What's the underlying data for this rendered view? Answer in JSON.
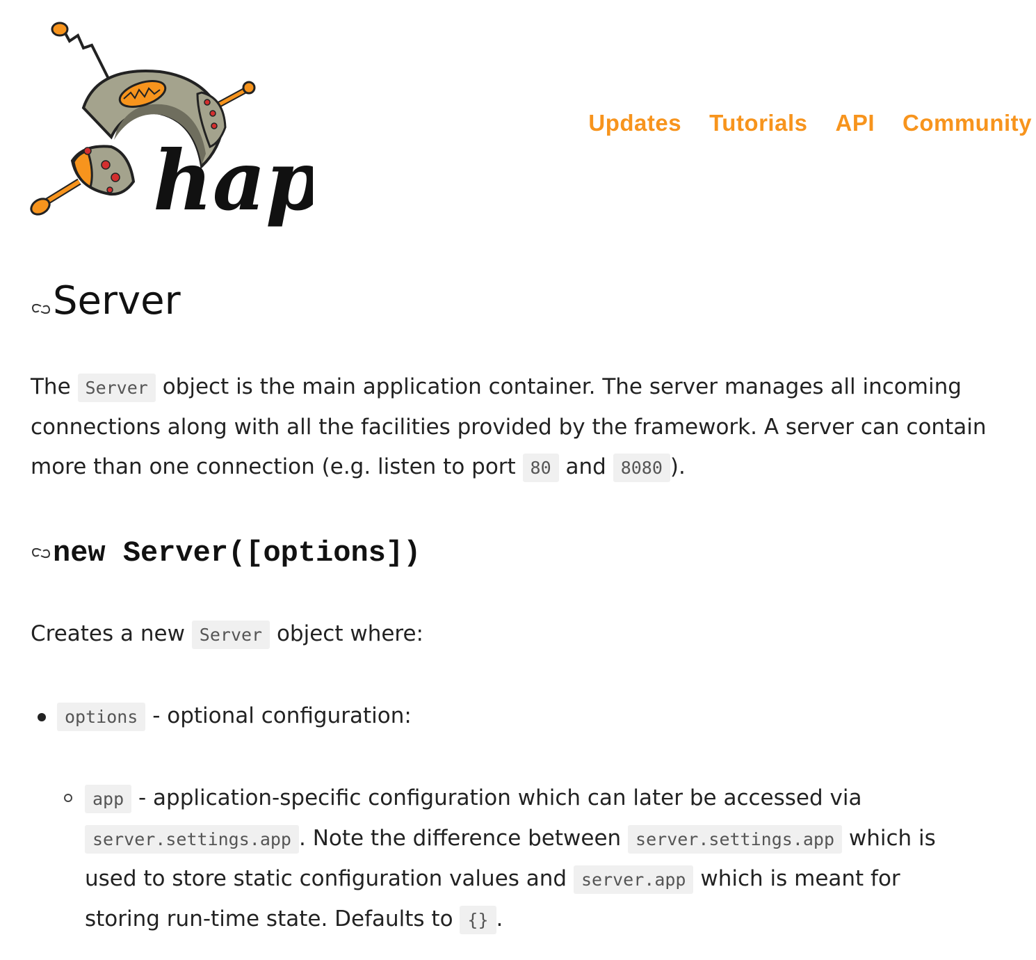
{
  "logo": {
    "text": "hapi"
  },
  "nav": {
    "items": [
      "Updates",
      "Tutorials",
      "API",
      "Community"
    ]
  },
  "section": {
    "title": "Server",
    "intro": {
      "t1": "The",
      "c1": "Server",
      "t2": "object is the main application container. The server manages all incoming connections along with all the facilities provided by the framework. A server can contain more than one connection (e.g. listen to port",
      "c2": "80",
      "t3": "and",
      "c3": "8080",
      "t4": ")."
    }
  },
  "subsection": {
    "title": "new Server([options])",
    "desc": {
      "t1": "Creates a new",
      "c1": "Server",
      "t2": "object where:"
    },
    "options_item": {
      "code": "options",
      "text": "- optional configuration:"
    },
    "app_item": {
      "c1": "app",
      "t1": "- application-specific configuration which can later be accessed via",
      "c2": "server.settings.app",
      "t2": ". Note the difference between",
      "c3": "server.settings.app",
      "t3": "which is used to store static configuration values and",
      "c4": "server.app",
      "t4": "which is meant for storing run-time state. Defaults to",
      "c5": "{}",
      "t5": "."
    }
  },
  "colors": {
    "accent": "#f7941d",
    "code_bg": "#f0f0f0"
  },
  "icons": [
    "link-icon"
  ]
}
